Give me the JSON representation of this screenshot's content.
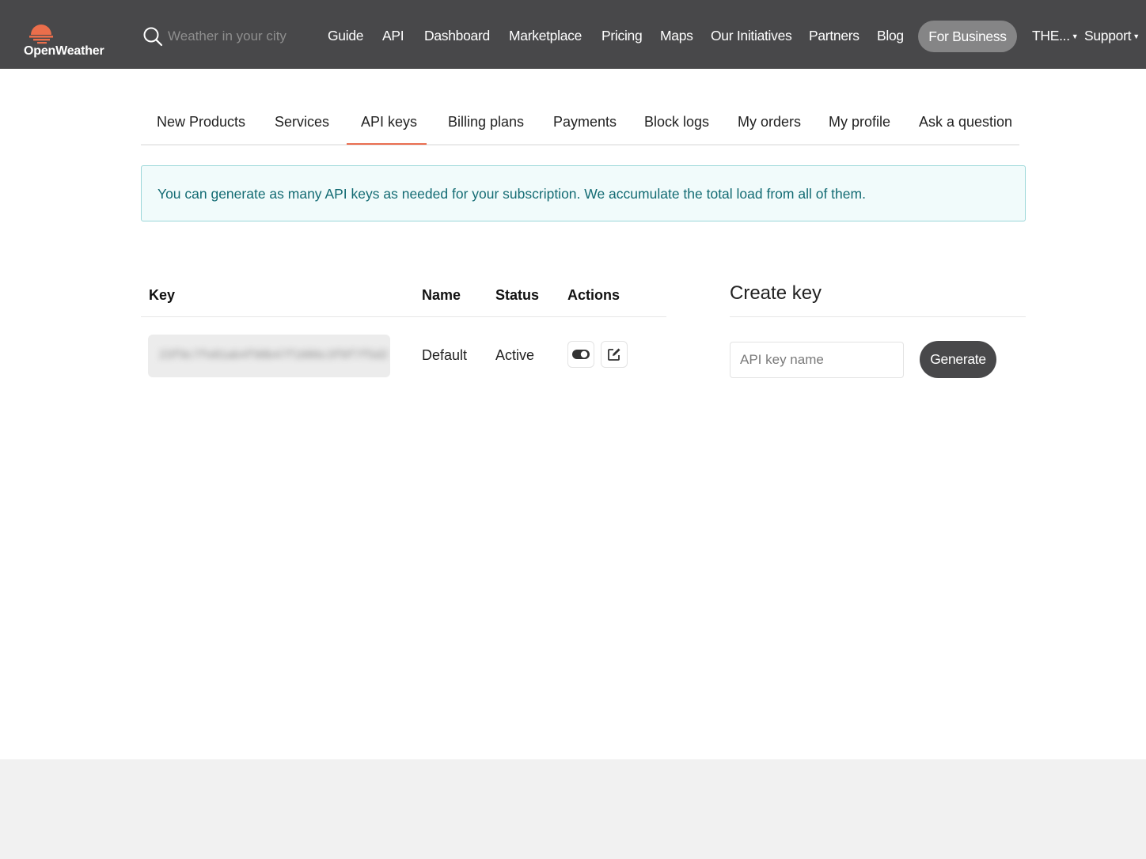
{
  "header": {
    "logo_text": "OpenWeather",
    "search_placeholder": "Weather in your city",
    "nav": [
      {
        "label": "Guide"
      },
      {
        "label": "API"
      },
      {
        "label": "Dashboard"
      },
      {
        "label": "Marketplace"
      },
      {
        "label": "Pricing"
      },
      {
        "label": "Maps"
      },
      {
        "label": "Our Initiatives"
      },
      {
        "label": "Partners"
      },
      {
        "label": "Blog"
      }
    ],
    "business_label": "For Business",
    "user_menu_label": "THE...",
    "support_label": "Support"
  },
  "tabs": [
    {
      "label": "New Products"
    },
    {
      "label": "Services"
    },
    {
      "label": "API keys",
      "active": true
    },
    {
      "label": "Billing plans"
    },
    {
      "label": "Payments"
    },
    {
      "label": "Block logs"
    },
    {
      "label": "My orders"
    },
    {
      "label": "My profile"
    },
    {
      "label": "Ask a question"
    }
  ],
  "banner": {
    "text": "You can generate as many API keys as needed for your subscription. We accumulate the total load from all of them."
  },
  "keys_table": {
    "headers": {
      "key": "Key",
      "name": "Name",
      "status": "Status",
      "actions": "Actions"
    },
    "rows": [
      {
        "key": "23f9c7fe81ab4f98b47f1086c3f0f7f5d2",
        "name": "Default",
        "status": "Active",
        "actions": [
          {
            "icon": "toggle-icon"
          },
          {
            "icon": "edit-icon"
          }
        ]
      }
    ]
  },
  "create_key": {
    "title": "Create key",
    "input_placeholder": "API key name",
    "button_label": "Generate"
  },
  "colors": {
    "topbar": "#48484a",
    "accent": "#e96e50",
    "banner_bg": "#f1fbfb",
    "banner_border": "#9bd7d9",
    "banner_text": "#136b73",
    "button_dark": "#48484a"
  }
}
